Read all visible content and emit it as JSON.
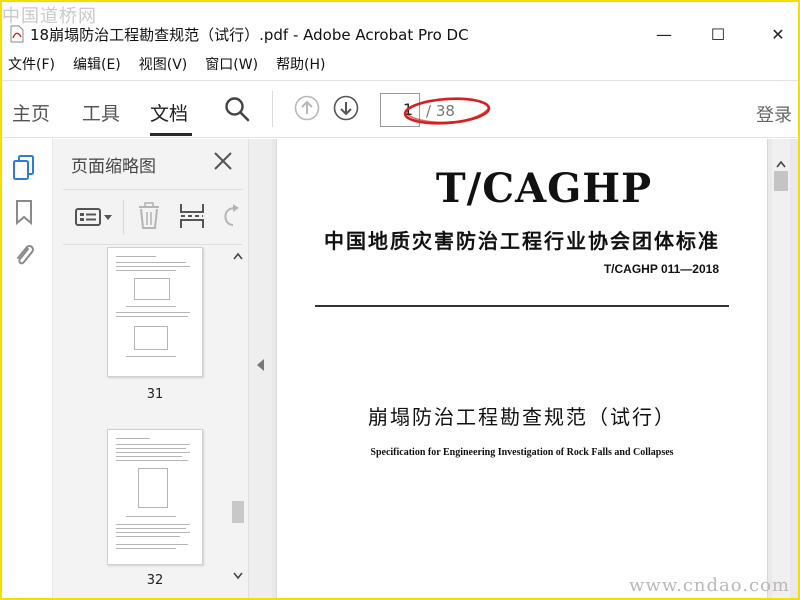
{
  "watermark_top": "中国道桥网",
  "watermark_bottom": "www.cndao.com",
  "window": {
    "title": "18崩塌防治工程勘查规范（试行）.pdf - Adobe Acrobat Pro DC",
    "minimize": "—",
    "maximize": "☐",
    "close": "✕"
  },
  "menu": [
    "文件(F)",
    "编辑(E)",
    "视图(V)",
    "窗口(W)",
    "帮助(H)"
  ],
  "toolbar": {
    "tabs": [
      "主页",
      "工具",
      "文档"
    ],
    "active_tab": "文档",
    "page_current": "1",
    "page_total": "/ 38",
    "login": "登录"
  },
  "thumb_panel": {
    "title": "页面缩略图",
    "pages": [
      "31",
      "32"
    ]
  },
  "document": {
    "code": "T/CAGHP",
    "organization": "中国地质灾害防治工程行业协会团体标准",
    "standard_no": "T/CAGHP 011—2018",
    "title_cn": "崩塌防治工程勘查规范（试行）",
    "title_en": "Specification for Engineering Investigation of  Rock Falls and Collapses"
  },
  "colors": {
    "frame": "#f4e000",
    "annotation_oval": "#d62020",
    "icon_blue": "#2d7bd8",
    "icon_gray": "#8a8a8a"
  }
}
